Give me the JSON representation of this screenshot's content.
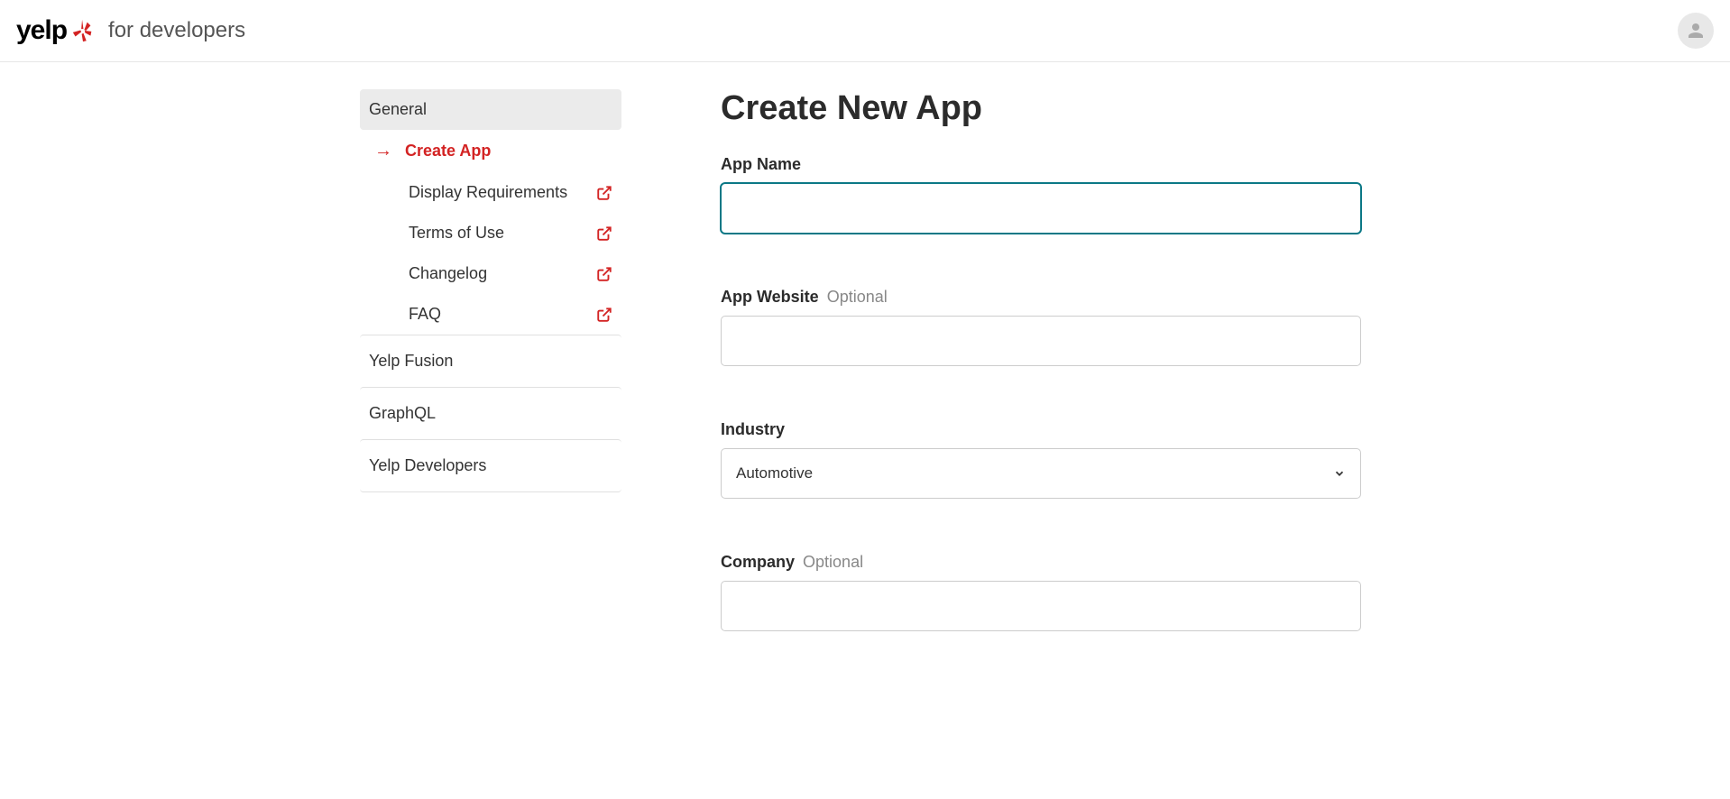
{
  "header": {
    "logo_text": "yelp",
    "subtitle": "for developers"
  },
  "sidebar": {
    "general_label": "General",
    "items": [
      {
        "label": "Create App"
      },
      {
        "label": "Display Requirements"
      },
      {
        "label": "Terms of Use"
      },
      {
        "label": "Changelog"
      },
      {
        "label": "FAQ"
      }
    ],
    "sections": [
      {
        "label": "Yelp Fusion"
      },
      {
        "label": "GraphQL"
      },
      {
        "label": "Yelp Developers"
      }
    ]
  },
  "main": {
    "title": "Create New App",
    "form": {
      "app_name_label": "App Name",
      "app_name_value": "",
      "app_website_label": "App Website",
      "app_website_optional": "Optional",
      "app_website_value": "",
      "industry_label": "Industry",
      "industry_selected": "Automotive",
      "company_label": "Company",
      "company_optional": "Optional",
      "company_value": ""
    }
  }
}
